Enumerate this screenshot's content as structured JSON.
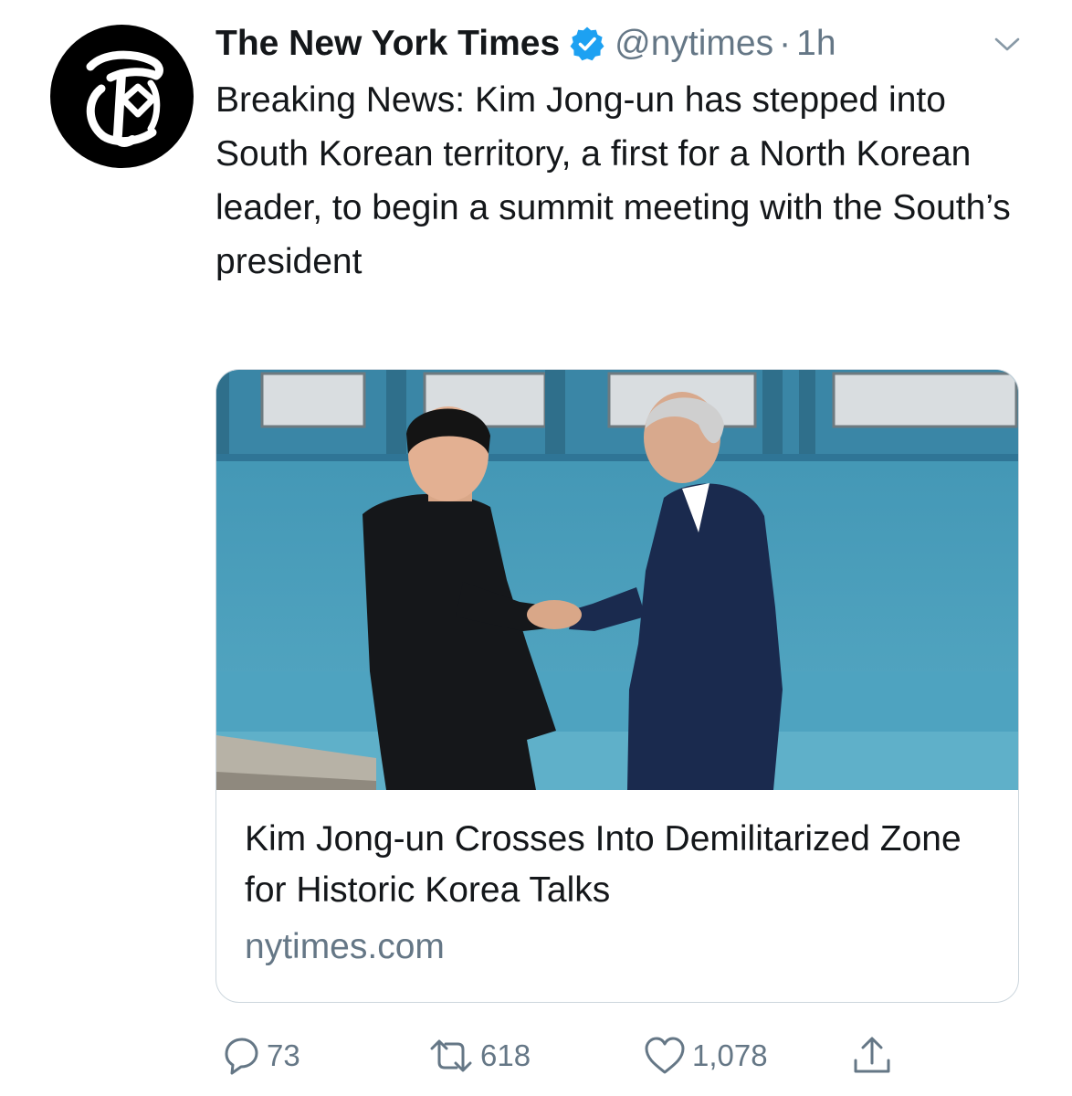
{
  "tweet": {
    "author": {
      "display_name": "The New York Times",
      "handle": "@nytimes",
      "verified": true,
      "avatar_icon": "nyt-t-logo-icon"
    },
    "separator": "·",
    "time": "1h",
    "text": "Breaking News: Kim Jong-un has stepped into South Korean territory, a first for a North Korean leader, to begin a summit meeting with the South’s president",
    "card": {
      "image_icon": "handshake-photo",
      "title": "Kim Jong-un Crosses Into Demilitarized Zone for Historic Korea Talks",
      "domain": "nytimes.com"
    },
    "actions": {
      "replies": "73",
      "retweets": "618",
      "likes": "1,078",
      "share_icon": "share-icon"
    }
  },
  "colors": {
    "text": "#14171a",
    "secondary": "#657786",
    "verified": "#1da1f2",
    "card_border": "#ccd6dd",
    "wall": "#3f93b2"
  }
}
